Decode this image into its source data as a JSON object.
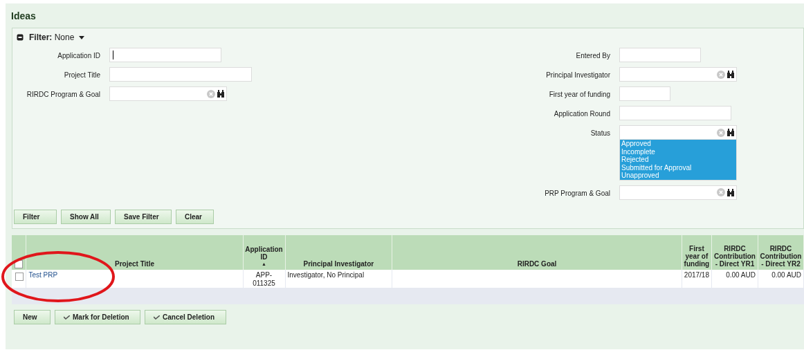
{
  "page": {
    "title": "Ideas"
  },
  "filter": {
    "label": "Filter:",
    "value": "None",
    "expanded": true,
    "left_fields": [
      {
        "label": "Application ID",
        "kind": "text",
        "focused": true
      },
      {
        "label": "Project Title",
        "kind": "text"
      },
      {
        "label": "RIRDC Program & Goal",
        "kind": "lookup"
      }
    ],
    "right_fields": [
      {
        "label": "Entered By",
        "kind": "text"
      },
      {
        "label": "Principal Investigator",
        "kind": "lookup"
      },
      {
        "label": "First year of funding",
        "kind": "text"
      },
      {
        "label": "Application Round",
        "kind": "text"
      },
      {
        "label": "Status",
        "kind": "lookup_list",
        "options": [
          {
            "label": "Approved",
            "selected": true
          },
          {
            "label": "Incomplete",
            "selected": true
          },
          {
            "label": "Rejected",
            "selected": true
          },
          {
            "label": "Submitted for Approval",
            "selected": true
          },
          {
            "label": "Unapproved",
            "selected": true
          }
        ]
      },
      {
        "label": "PRP Program & Goal",
        "kind": "lookup"
      }
    ],
    "buttons": [
      "Filter",
      "Show All",
      "Save Filter",
      "Clear"
    ]
  },
  "table": {
    "select_all": {
      "checked": false
    },
    "columns": [
      {
        "label": "Project Title"
      },
      {
        "label": "Application ID",
        "sort": "▲"
      },
      {
        "label": "Principal Investigator"
      },
      {
        "label": "RIRDC Goal"
      },
      {
        "label": "First year of funding"
      },
      {
        "label": "RIRDC Contribution - Direct YR1"
      },
      {
        "label": "RIRDC Contribution - Direct YR2"
      }
    ],
    "rows": [
      {
        "checked": false,
        "cells": [
          "Test PRP",
          "APP-011325",
          "Investigator, No Principal",
          "",
          "2017/18",
          "0.00 AUD",
          "0.00 AUD"
        ]
      }
    ]
  },
  "actions": [
    {
      "label": "New",
      "icon": false
    },
    {
      "label": "Mark for Deletion",
      "icon": true
    },
    {
      "label": "Cancel Deletion",
      "icon": true
    }
  ],
  "annotation": {
    "kind": "ellipse",
    "color": "#e0161b"
  }
}
